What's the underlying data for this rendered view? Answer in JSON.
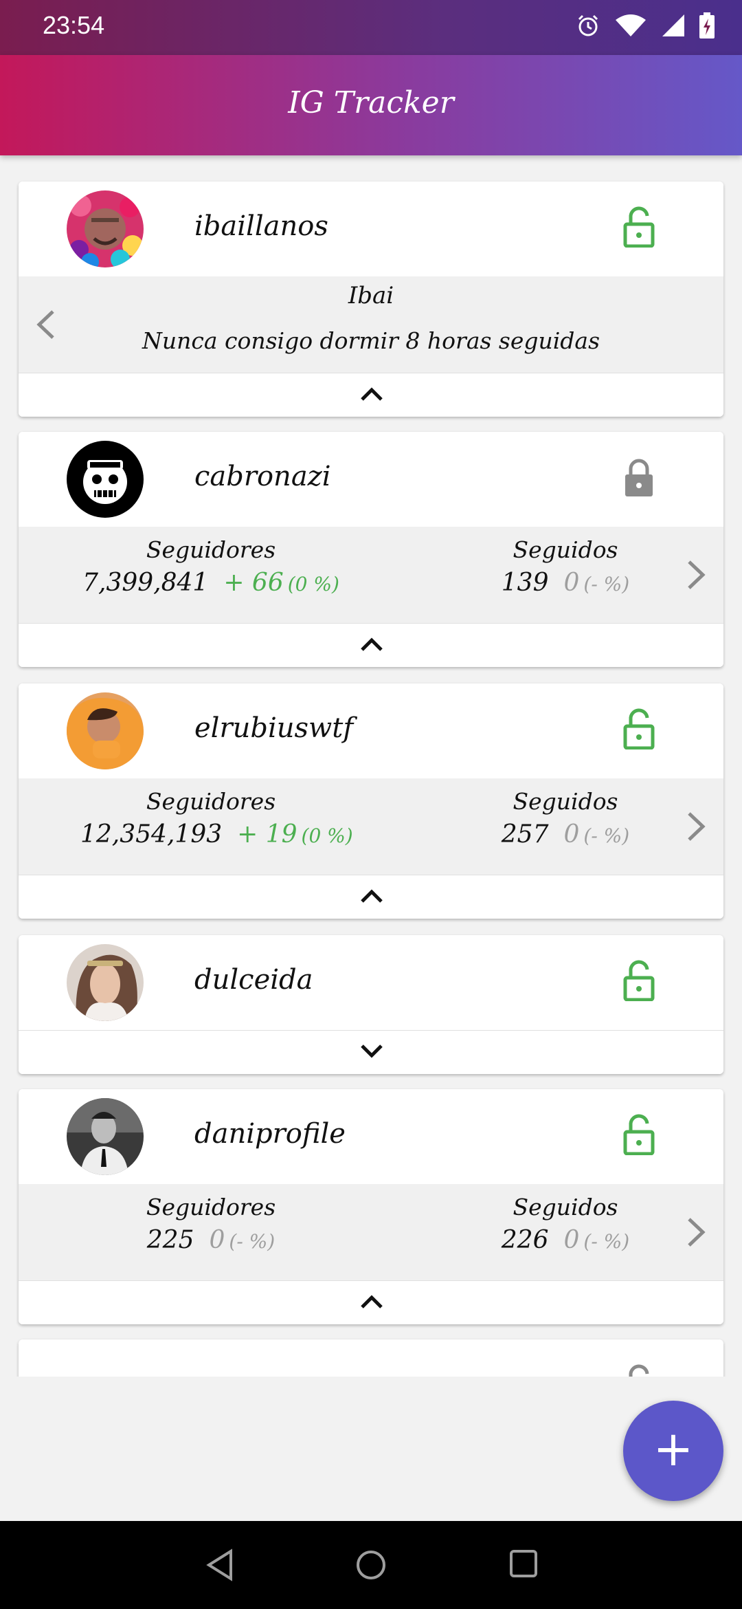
{
  "status_bar": {
    "time": "23:54",
    "icons": [
      "alarm-icon",
      "wifi-icon",
      "signal-icon",
      "battery-charging-icon"
    ]
  },
  "app_bar": {
    "title": "IG Tracker"
  },
  "colors": {
    "accent": "#5c57c9",
    "positive": "#4caf50",
    "neutral": "#9e9e9e",
    "lock_open": "#4caf50",
    "lock_closed": "#8a8a8a"
  },
  "cards": [
    {
      "username": "ibaillanos",
      "lock": "unlocked",
      "bio_name": "Ibai",
      "bio_text": "Nunca consigo dormir 8 horas seguidas",
      "toggle": "collapse"
    },
    {
      "username": "cabronazi",
      "lock": "locked",
      "followers_label": "Seguidores",
      "followers": "7,399,841",
      "followers_delta": "+ 66",
      "followers_pct": "(0 %)",
      "following_label": "Seguidos",
      "following": "139",
      "following_delta": "0",
      "following_pct": "(- %)",
      "toggle": "collapse"
    },
    {
      "username": "elrubiuswtf",
      "lock": "unlocked",
      "followers_label": "Seguidores",
      "followers": "12,354,193",
      "followers_delta": "+ 19",
      "followers_pct": "(0 %)",
      "following_label": "Seguidos",
      "following": "257",
      "following_delta": "0",
      "following_pct": "(- %)",
      "toggle": "collapse"
    },
    {
      "username": "dulceida",
      "lock": "unlocked",
      "toggle": "expand"
    },
    {
      "username": "daniprofile",
      "lock": "unlocked",
      "followers_label": "Seguidores",
      "followers": "225",
      "followers_delta": "0",
      "followers_pct": "(- %)",
      "following_label": "Seguidos",
      "following": "226",
      "following_delta": "0",
      "following_pct": "(- %)",
      "toggle": "collapse"
    }
  ],
  "fab": {
    "label": "+"
  }
}
